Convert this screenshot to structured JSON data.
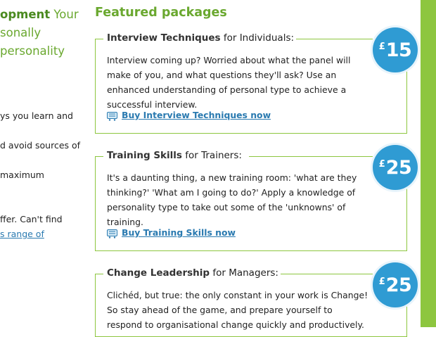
{
  "left": {
    "heading_bold": "opment",
    "heading_rest": "Your",
    "heading_line2": "sonally",
    "heading_line3": "personality",
    "lines": [
      "ys you learn and",
      "d avoid sources of",
      "maximum",
      "ffer. Can't find"
    ],
    "link_fragment": "s range of"
  },
  "featured": {
    "title": "Featured packages",
    "packages": [
      {
        "name": "Interview Techniques",
        "audience": "for Individuals:",
        "description": "Interview coming up? Worried about what the panel will make of you, and what questions they'll ask? Use an enhanced understanding of personal type to achieve a successful interview.",
        "buy_label": "Buy Interview Techniques now",
        "currency": "£",
        "price": "15"
      },
      {
        "name": "Training Skills",
        "audience": "for Trainers:",
        "description": "It's a daunting thing, a new training room: 'what are they thinking?' 'What am I going to do?' Apply a knowledge of personality type to take out some of the 'unknowns' of training.",
        "buy_label": "Buy Training Skills now",
        "currency": "£",
        "price": "25"
      },
      {
        "name": "Change Leadership",
        "audience": "for Managers:",
        "description": "Clichéd, but true: the only constant in your work is Change! So stay ahead of the game, and prepare yourself to respond to organisational change quickly and productively.",
        "buy_label": "",
        "currency": "£",
        "price": "25"
      }
    ]
  },
  "icons": {
    "cart": "shopping-cart-icon"
  },
  "colors": {
    "accent_green": "#8dc63f",
    "heading_green": "#6aa82f",
    "price_blue": "#2f9bd3",
    "link_blue": "#2a7ab0"
  }
}
